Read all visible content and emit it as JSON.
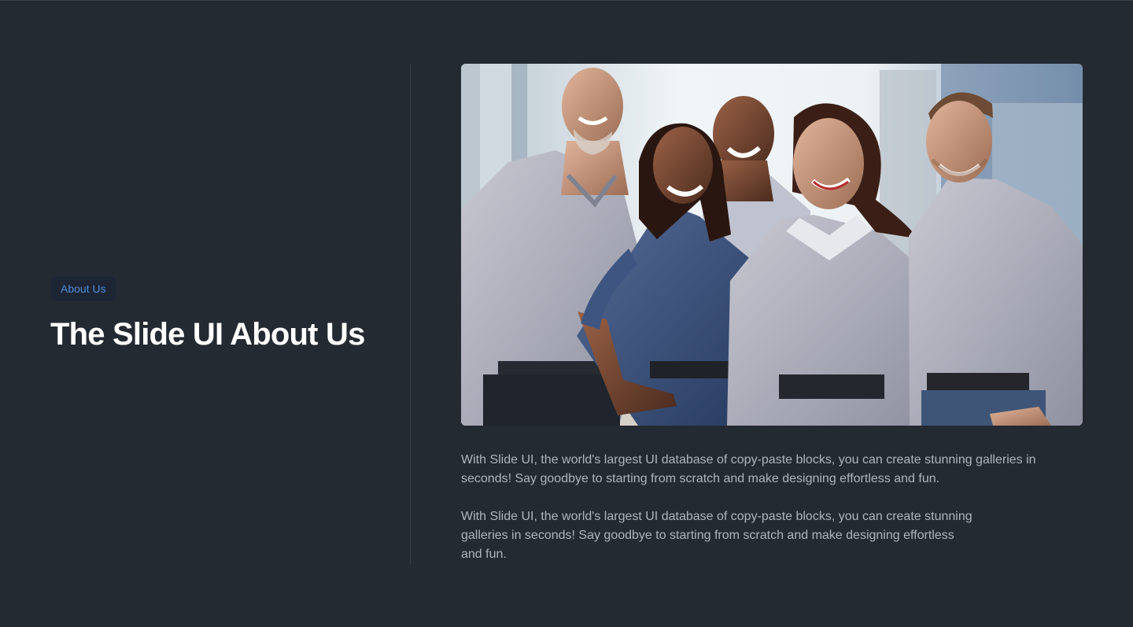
{
  "hero": {
    "badge": "About Us",
    "title": "The Slide UI About Us"
  },
  "image": {
    "alt": "Five smiling team members in work uniforms standing outdoors"
  },
  "content": {
    "paragraph_1": "With Slide UI, the world's largest UI database of copy-paste blocks, you can create stunning galleries in seconds! Say goodbye to starting from scratch and make designing effortless and fun.",
    "paragraph_2": "With Slide UI, the world's largest UI database of copy-paste blocks, you can create stunning galleries in seconds! Say goodbye to starting from scratch and make designing effortless and fun."
  },
  "colors": {
    "background": "#242a31",
    "badge_text": "#4f8fd7",
    "title": "#ffffff",
    "body_text": "#aeb5bd"
  }
}
